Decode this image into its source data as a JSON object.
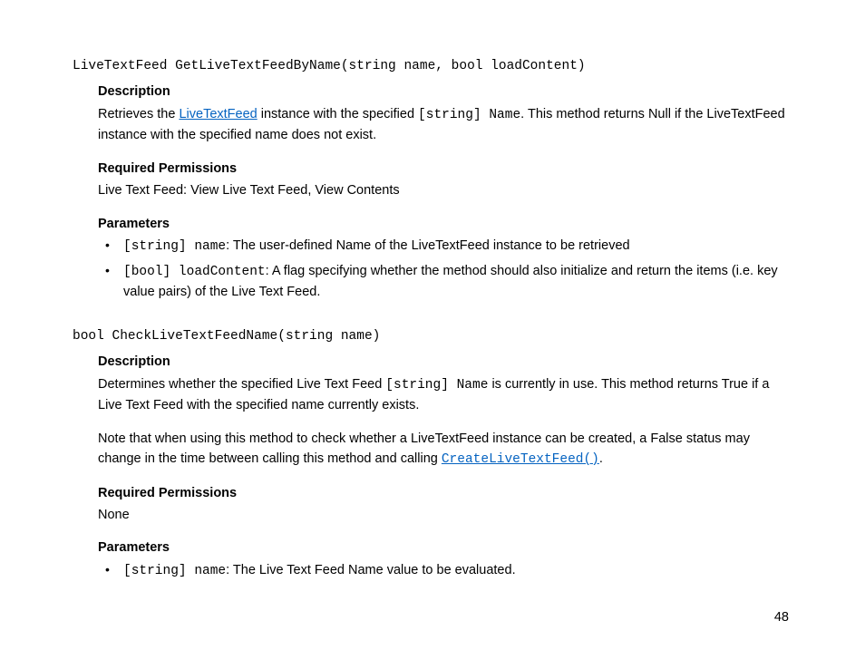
{
  "method1": {
    "signature": "LiveTextFeed GetLiveTextFeedByName(string name, bool loadContent)",
    "desc_label": "Description",
    "desc_pre": "Retrieves the ",
    "desc_link": "LiveTextFeed",
    "desc_mid": " instance with the specified ",
    "desc_code": "[string] Name",
    "desc_post": ". This method returns Null if the LiveTextFeed instance with the specified name does not exist.",
    "perm_label": "Required Permissions",
    "perm_text": "Live Text Feed: View Live Text Feed, View Contents",
    "params_label": "Parameters",
    "param1_code": "[string] name",
    "param1_text": ": The user-defined Name of the LiveTextFeed instance to be retrieved",
    "param2_code": "[bool] loadContent",
    "param2_text": ": A flag specifying whether the method should also initialize and return the items (i.e. key value pairs) of the Live Text Feed."
  },
  "method2": {
    "signature": "bool CheckLiveTextFeedName(string name)",
    "desc_label": "Description",
    "desc_pre": "Determines whether the specified Live Text Feed ",
    "desc_code": "[string] Name",
    "desc_post": " is currently in use. This method returns True if a Live Text Feed with the specified name currently exists.",
    "note_pre": "Note that when using this method to check whether a LiveTextFeed instance can be created, a False status may change in the time between calling this method and calling ",
    "note_link": "CreateLiveTextFeed()",
    "note_post": ".",
    "perm_label": "Required Permissions",
    "perm_text": "None",
    "params_label": "Parameters",
    "param1_code": "[string] name",
    "param1_text": ": The Live Text Feed Name value to be evaluated."
  },
  "page_number": "48"
}
